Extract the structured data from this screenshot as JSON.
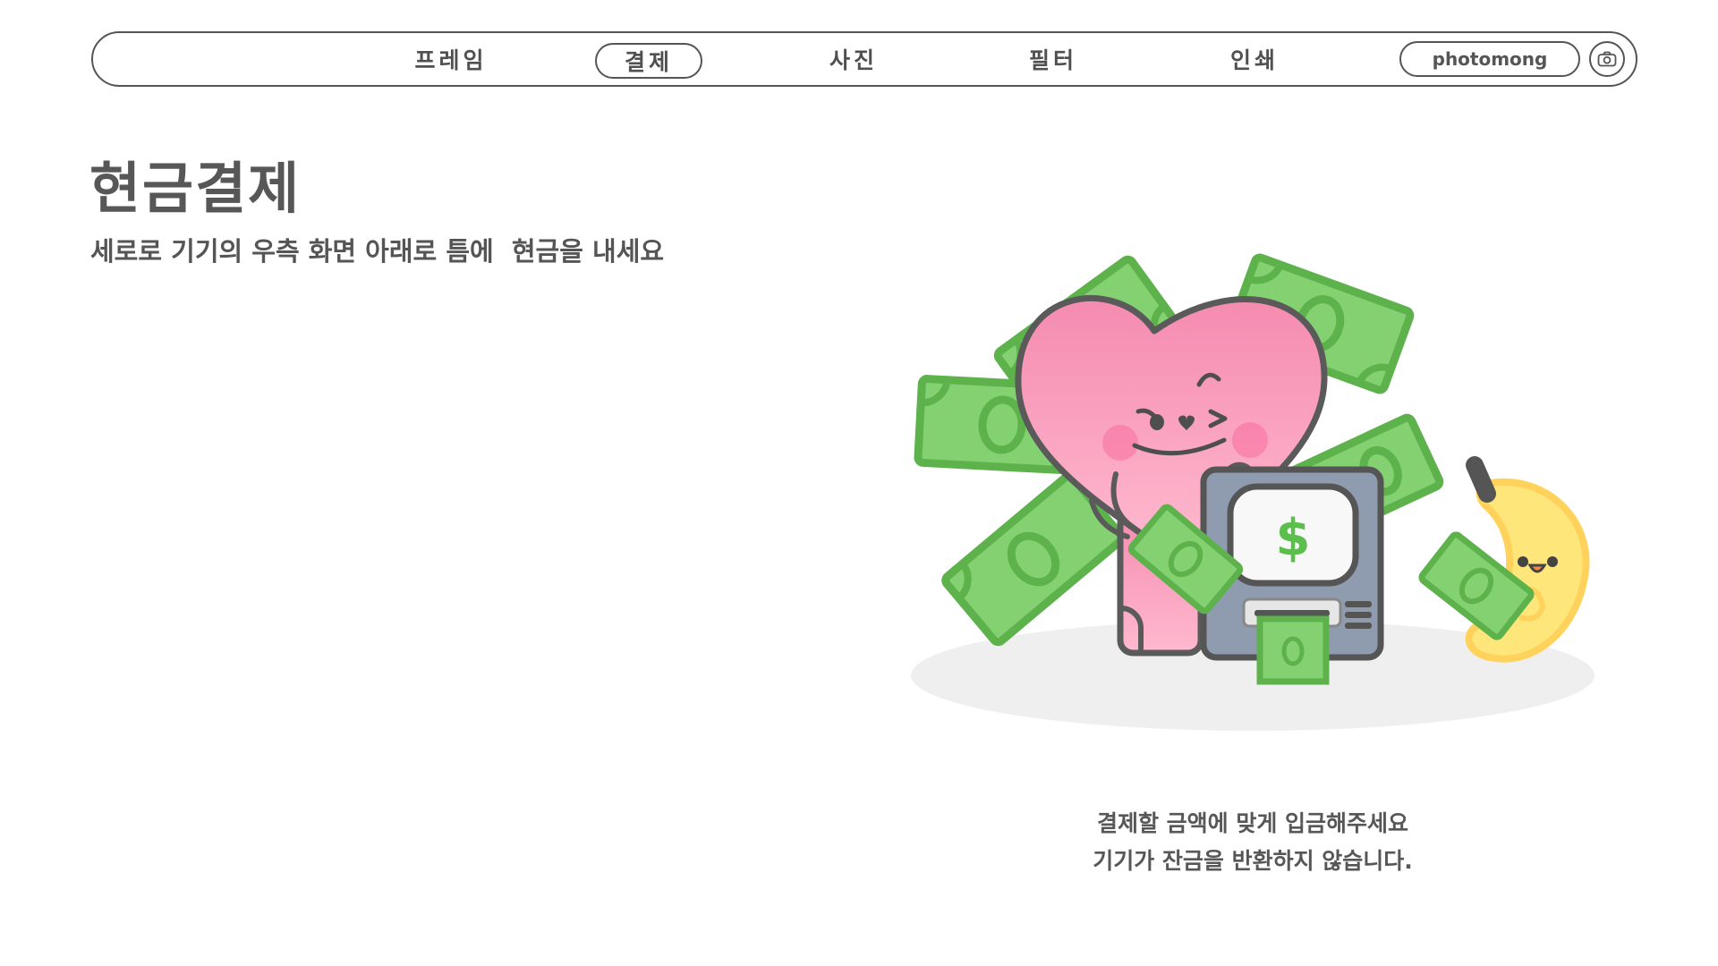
{
  "nav": {
    "items": [
      {
        "label": "프레임",
        "active": false
      },
      {
        "label": "결제",
        "active": true
      },
      {
        "label": "사진",
        "active": false
      },
      {
        "label": "필터",
        "active": false
      },
      {
        "label": "인쇄",
        "active": false
      }
    ],
    "brand": "photomong",
    "camera_icon": "camera-icon"
  },
  "main": {
    "title": "현금결제",
    "subtitle": "세로로 기기의 우측 화면 아래로 틈에  현금을 내세요",
    "illustration": {
      "atm_screen_symbol": "$",
      "characters": [
        "heart-character",
        "banana-character"
      ]
    },
    "notice_lines": [
      "결제할 금액에 맞게 입금해주세요",
      "기기가 잔금을 반환하지 않습니다."
    ]
  },
  "colors": {
    "text": "#555555",
    "border": "#555555",
    "money_green": "#7ccd6b",
    "money_dark": "#5aac4c",
    "heart_pink": "#f7a4c0",
    "atm_gray": "#8f9bb0",
    "banana_yellow": "#ffe67a"
  }
}
